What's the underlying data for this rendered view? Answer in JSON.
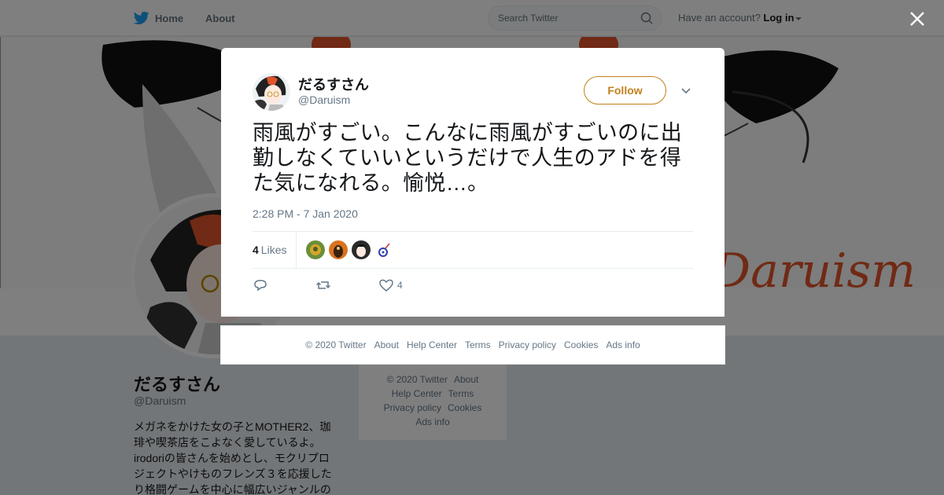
{
  "topbar": {
    "home_label": "Home",
    "about_label": "About",
    "search_placeholder": "Search Twitter",
    "account_prompt": "Have an account?",
    "login_label": "Log in"
  },
  "banner": {
    "text": "Daruism"
  },
  "profile": {
    "name": "だるすさん",
    "handle": "@Daruism",
    "bio": "メガネをかけた女の子とMOTHER2、珈琲や喫茶店をこよなく愛しているよ。irodoriの皆さんを始めとし、モクリプロジェクトやけものフレンズ３を応援したり格闘ゲームを中心に幅広いジャンルの"
  },
  "side_footer": {
    "copyright": "© 2020 Twitter",
    "about": "About",
    "help": "Help Center",
    "terms": "Terms",
    "privacy": "Privacy policy",
    "cookies": "Cookies",
    "ads": "Ads info"
  },
  "tweet": {
    "user_name": "だるすさん",
    "user_handle": "@Daruism",
    "follow_label": "Follow",
    "text": "雨風がすごい。こんなに雨風がすごいのに出勤しなくていいというだけで人生のアドを得た気になれる。愉悦…。",
    "timestamp": "2:28 PM - 7 Jan 2020",
    "likes_count": "4",
    "likes_label": "Likes",
    "like_action_count": "4"
  },
  "modal_footer": {
    "copyright": "© 2020 Twitter",
    "about": "About",
    "help": "Help Center",
    "terms": "Terms",
    "privacy": "Privacy policy",
    "cookies": "Cookies",
    "ads": "Ads info"
  },
  "colors": {
    "twitter_blue": "#1da1f2",
    "follow_accent": "#c3801c",
    "banner_accent": "#e0542a"
  }
}
